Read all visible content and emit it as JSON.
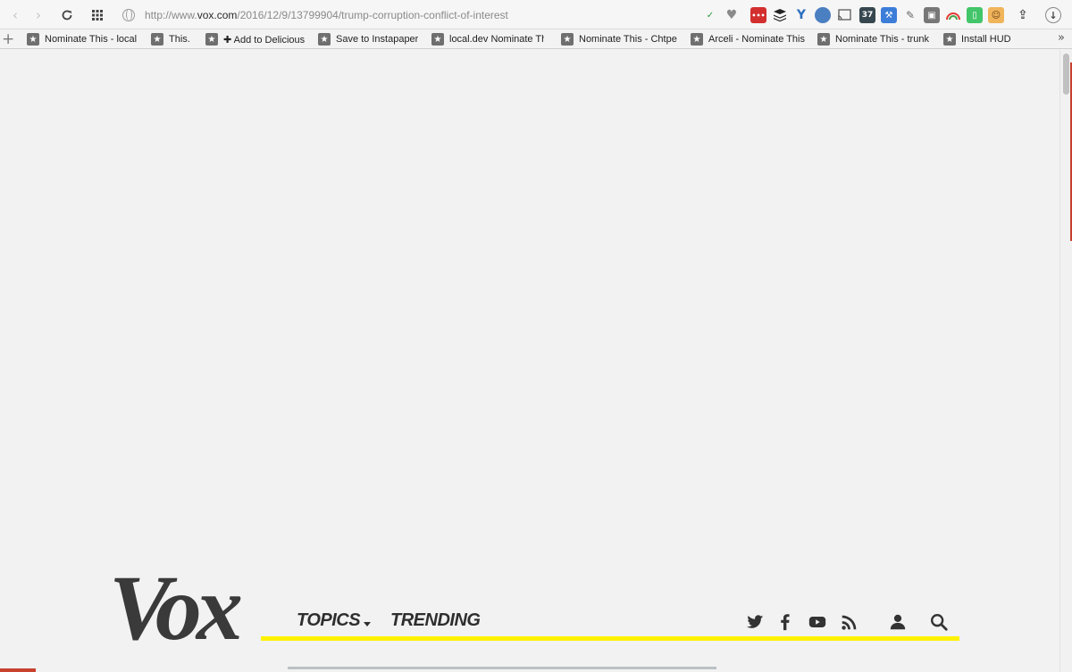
{
  "browser": {
    "url": {
      "prefix": "http://www.",
      "domain": "vox.com",
      "path": "/2016/12/9/13799904/trump-corruption-conflict-of-interest"
    },
    "extensions": [
      "vox-pin-icon",
      "heart-icon",
      "lastpass-icon",
      "buffer-icon",
      "yslow-icon",
      "globe-icon",
      "cast-icon",
      "calendar-icon",
      "tools-icon",
      "notes-icon",
      "screenshot-icon",
      "rainbow-icon",
      "evernote-icon",
      "face-icon",
      "share-icon",
      "download-icon"
    ],
    "calendar_badge": "37"
  },
  "bookmarks": {
    "items": [
      "Nominate This - local",
      "This.",
      "✚ Add to Delicious",
      "Save to Instapaper",
      "local.dev Nominate This",
      "Nominate This - Chtpe",
      "Arceli - Nominate This",
      "Nominate This - trunk",
      "Install HUD"
    ],
    "more": "»"
  },
  "site": {
    "logo_text": "Vox",
    "nav": {
      "topics": "TOPICS",
      "trending": "TRENDING"
    },
    "accent": "#fff200",
    "social": [
      "twitter-icon",
      "facebook-icon",
      "youtube-icon",
      "rss-icon",
      "user-icon",
      "search-icon"
    ]
  }
}
